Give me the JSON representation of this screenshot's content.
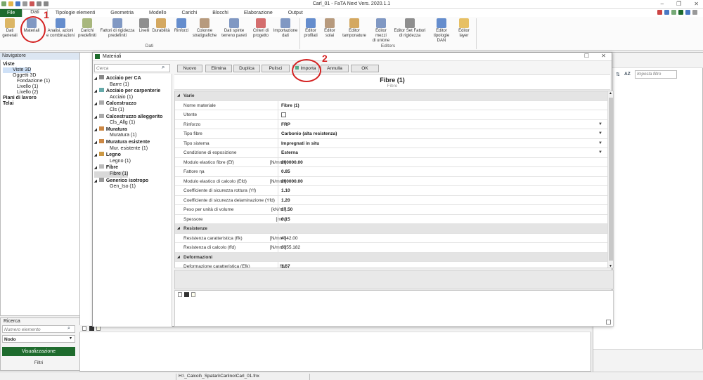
{
  "window": {
    "title": "Carl_01 - FaTA Next Vers. 2020.1.1"
  },
  "menu": [
    {
      "label": "File"
    },
    {
      "label": "Dati"
    },
    {
      "label": "Tipologie elementi"
    },
    {
      "label": "Geometria"
    },
    {
      "label": "Modello"
    },
    {
      "label": "Carichi"
    },
    {
      "label": "Blocchi"
    },
    {
      "label": "Elaborazione"
    },
    {
      "label": "Output"
    }
  ],
  "ribbon": {
    "dati_group": "Dati",
    "editors_group": "Editors",
    "buttons": [
      {
        "l1": "Dati",
        "l2": "generali"
      },
      {
        "l1": "Materiali",
        "l2": ""
      },
      {
        "l1": "Analisi, azioni",
        "l2": "e combinazioni"
      },
      {
        "l1": "Carichi",
        "l2": "predefiniti"
      },
      {
        "l1": "Fattori di rigidezza",
        "l2": "predefiniti"
      },
      {
        "l1": "Livelli",
        "l2": ""
      },
      {
        "l1": "Durabilità",
        "l2": ""
      },
      {
        "l1": "Rinforzi",
        "l2": ""
      },
      {
        "l1": "Colonne",
        "l2": "stratigrafiche"
      },
      {
        "l1": "Dati spinte",
        "l2": "terreno pareti"
      },
      {
        "l1": "Criteri di",
        "l2": "progetto"
      },
      {
        "l1": "Importazione",
        "l2": "dati"
      },
      {
        "l1": "Editor",
        "l2": "profilati"
      },
      {
        "l1": "Editor",
        "l2": "solai"
      },
      {
        "l1": "Editor",
        "l2": "tamponature"
      },
      {
        "l1": "Editor mezzi",
        "l2": "di unione"
      },
      {
        "l1": "Editor Set Fattori",
        "l2": "di rigidezza"
      },
      {
        "l1": "Editor",
        "l2": "tipologie DAN"
      },
      {
        "l1": "Editor",
        "l2": "layer"
      }
    ]
  },
  "navigator": {
    "title": "Navigatore",
    "viste": "Viste",
    "items": [
      "Viste 3D",
      "Oggetti 3D",
      "Fondazione (1)",
      "Livello (1)",
      "Livello (2)"
    ],
    "piani": "Piani di lavoro",
    "telai": "Telai"
  },
  "search": {
    "title": "Ricerca",
    "placeholder": "Numero elemento",
    "node": "Nodo",
    "visualize": "Visualizzazione",
    "filters": "Filtri"
  },
  "right_panel": {
    "filter_placeholder": "Imposta filtro"
  },
  "status": {
    "path": "H:\\_Calcoli\\_Spatari\\Carlino\\Carl_01.fnx"
  },
  "dialog": {
    "title": "Materiali",
    "search_placeholder": "Cerca",
    "toolbar": [
      "Nuovo",
      "Elimina",
      "Duplica",
      "Pulisci",
      "Importa",
      "Annulla",
      "OK"
    ],
    "header_title": "Fibre (1)",
    "header_sub": "Fibre",
    "tree": [
      {
        "cat": "Acciaio per CA",
        "child": "Barre (1)"
      },
      {
        "cat": "Acciaio per carpenterie",
        "child": "Acciaio (1)"
      },
      {
        "cat": "Calcestruzzo",
        "child": "Cls (1)"
      },
      {
        "cat": "Calcestruzzo alleggerito",
        "child": "Cls_Allg (1)"
      },
      {
        "cat": "Muratura",
        "child": "Muratura (1)"
      },
      {
        "cat": "Muratura esistente",
        "child": "Mur. esistente (1)"
      },
      {
        "cat": "Legno",
        "child": "Legno (1)"
      },
      {
        "cat": "Fibre",
        "child": "Fibre (1)"
      },
      {
        "cat": "Generico isotropo",
        "child": "Gen_Iso (1)"
      }
    ],
    "props": [
      {
        "label": "Varie",
        "section": true
      },
      {
        "label": "Nome materiale",
        "unit": "",
        "value": "Fibre (1)"
      },
      {
        "label": "Utente",
        "unit": "",
        "value": "",
        "checkbox": true
      },
      {
        "label": "Rinforzo",
        "unit": "",
        "value": "FRP",
        "dropdown": true
      },
      {
        "label": "Tipo fibre",
        "unit": "",
        "value": "Carbonio (alta resistenza)",
        "dropdown": true
      },
      {
        "label": "Tipo sistema",
        "unit": "",
        "value": "Impregnati in situ",
        "dropdown": true
      },
      {
        "label": "Condizione di esposizione",
        "unit": "",
        "value": "Esterna",
        "dropdown": true
      },
      {
        "label": "Modulo elastico fibre (Ef)",
        "unit": "[N/mm²]",
        "value": "260000.00"
      },
      {
        "label": "Fattore ηa",
        "unit": "",
        "value": "0.85"
      },
      {
        "label": "Modulo elastico di calcolo (Efd)",
        "unit": "[N/mm²]",
        "value": "260000.00"
      },
      {
        "label": "Coefficiente di sicurezza rottura (Yf)",
        "unit": "",
        "value": "1.10"
      },
      {
        "label": "Coefficiente di sicurezza delaminazione (Yfd)",
        "unit": "",
        "value": "1.20"
      },
      {
        "label": "Peso per unità di volume",
        "unit": "[kN/m³]",
        "value": "17.50"
      },
      {
        "label": "Spessore",
        "unit": "[mm]",
        "value": "0.15"
      },
      {
        "label": "Resistenze",
        "section": true
      },
      {
        "label": "Resistenza caratteristica (ffk)",
        "unit": "[N/mm²]",
        "value": "4342.00",
        "normal": true
      },
      {
        "label": "Resistenza di calcolo (ffd)",
        "unit": "[N/mm²]",
        "value": "3355.182",
        "normal": true
      },
      {
        "label": "Deformazioni",
        "section": true
      },
      {
        "label": "Deformazione caratteristica (Efk)",
        "unit": "[%]",
        "value": "1.67"
      }
    ]
  },
  "annotations": {
    "one": "1",
    "two": "2"
  },
  "colors": {
    "accent_green": "#1e6b2d",
    "callout_red": "#d42222",
    "nav_header": "#dce6f2"
  }
}
